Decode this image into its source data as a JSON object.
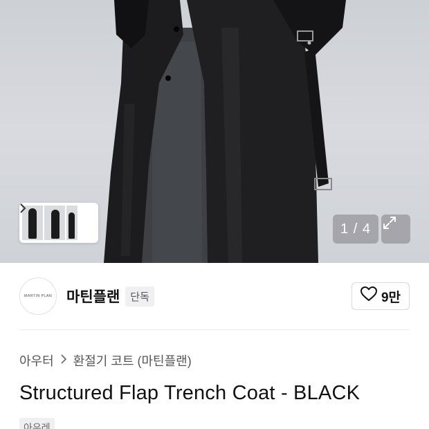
{
  "gallery": {
    "counter_text": "1 / 4",
    "current_index": 1,
    "total": 4,
    "thumbnail_chevron": "chevron-right-icon",
    "expand_icon": "expand-icon"
  },
  "brand": {
    "logo_text": "MARTIN PLAN",
    "name": "마틴플랜",
    "exclusive_tag": "단독",
    "like_icon": "heart-icon",
    "like_count": "9만"
  },
  "breadcrumb": {
    "items": [
      "아우터",
      "환절기 코트 (마틴플랜)"
    ],
    "separator_icon": "chevron-right-icon"
  },
  "product": {
    "title": "Structured Flap Trench Coat - BLACK",
    "category_tag": "아우레"
  },
  "colors": {
    "coat": "#1a1a1c",
    "background": "#d4d6db",
    "overlay_button": "#96969b",
    "tag_bg": "#f0f0f2"
  }
}
